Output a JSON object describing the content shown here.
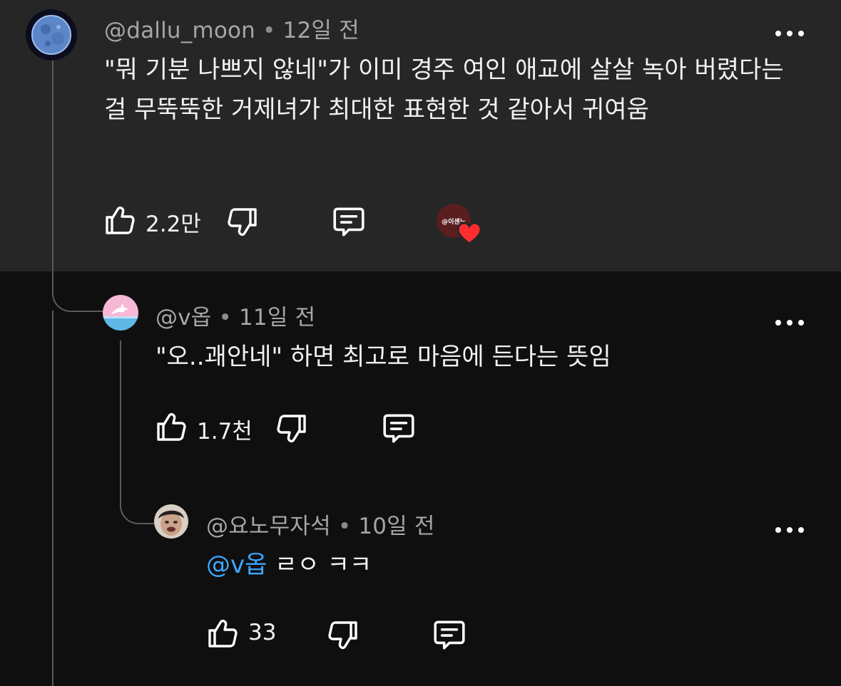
{
  "comments": [
    {
      "author": "@dallu_moon",
      "time": "12일 전",
      "text": "\"뭐 기분 나쁘지 않네\"가 이미 경주 여인 애교에 살살 녹아 버렸다는 걸 무뚝뚝한 거제녀가 최대한 표현한 것 같아서 귀여움",
      "likes": "2.2만",
      "avatar_icon": "moon-avatar",
      "creator_heart": {
        "badge_text": "@이센느",
        "icon": "heart-icon",
        "color": "#ff2d2d"
      }
    },
    {
      "author": "@v옵",
      "time": "11일 전",
      "text": "\"오..괘안네\" 하면 최고로 마음에 든다는 뜻임",
      "likes": "1.7천",
      "avatar_icon": "dolphin-avatar"
    },
    {
      "author": "@요노무자석",
      "time": "10일 전",
      "mention": "@v옵",
      "text": "ㄹㅇ ㅋㅋ",
      "likes": "33",
      "avatar_icon": "face-avatar"
    }
  ],
  "icons": {
    "like": "thumbs-up-icon",
    "dislike": "thumbs-down-icon",
    "reply": "reply-icon",
    "more": "more-options-icon"
  },
  "colors": {
    "highlight_bg": "#262626",
    "page_bg": "#0f0f0f",
    "mention": "#3ea6ff",
    "meta": "#a6a6a6"
  }
}
